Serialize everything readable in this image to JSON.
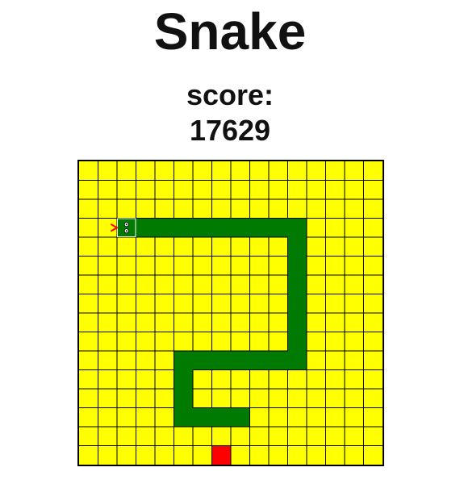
{
  "game": {
    "title": "Snake",
    "score_label": "score:",
    "score_value": "17629"
  },
  "board": {
    "cols": 16,
    "rows": 16,
    "background_color": "#ffff00",
    "grid_line_color": "#000000",
    "snake_color": "#007a00",
    "food_color": "#ff0000",
    "tongue_color": "#ff0000",
    "head": {
      "col": 2,
      "row": 3,
      "direction": "left"
    },
    "snake": [
      [
        2,
        3
      ],
      [
        3,
        3
      ],
      [
        4,
        3
      ],
      [
        5,
        3
      ],
      [
        6,
        3
      ],
      [
        7,
        3
      ],
      [
        8,
        3
      ],
      [
        9,
        3
      ],
      [
        10,
        3
      ],
      [
        11,
        3
      ],
      [
        11,
        4
      ],
      [
        11,
        5
      ],
      [
        11,
        6
      ],
      [
        11,
        7
      ],
      [
        11,
        8
      ],
      [
        11,
        9
      ],
      [
        11,
        10
      ],
      [
        10,
        10
      ],
      [
        9,
        10
      ],
      [
        8,
        10
      ],
      [
        7,
        10
      ],
      [
        6,
        10
      ],
      [
        5,
        10
      ],
      [
        5,
        11
      ],
      [
        5,
        12
      ],
      [
        5,
        13
      ],
      [
        6,
        13
      ],
      [
        7,
        13
      ],
      [
        8,
        13
      ]
    ],
    "food": {
      "col": 7,
      "row": 15
    },
    "icons": {
      "head_eyes": "snake-eyes-icon",
      "tongue": "snake-tongue-icon"
    }
  }
}
